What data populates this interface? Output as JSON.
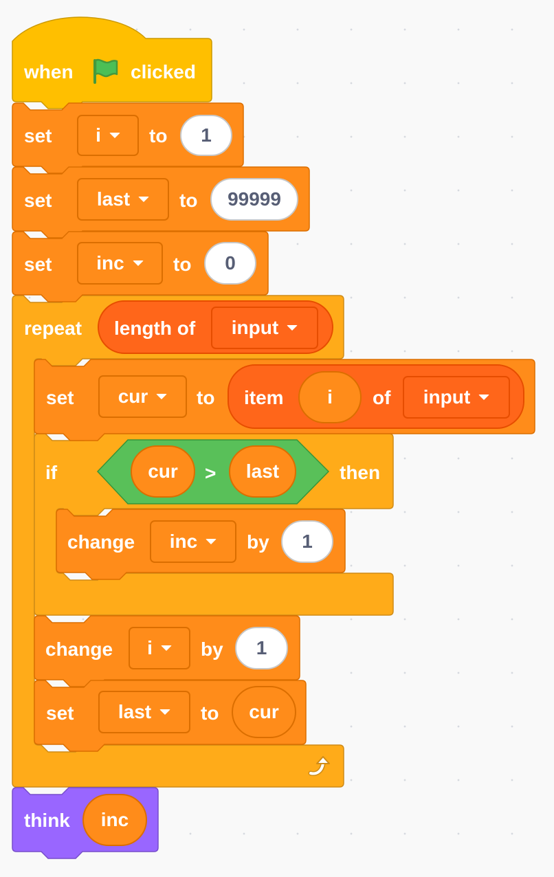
{
  "colors": {
    "events": "#ffbf00",
    "variables": "#ff8c1a",
    "control": "#ffab19",
    "operators": "#59c059",
    "looks": "#9966ff",
    "list": "#ff661a",
    "flag": "#4cbf56"
  },
  "script": {
    "hat": {
      "when": "when",
      "flag_icon": "green-flag-icon",
      "clicked": "clicked"
    },
    "set_i": {
      "set": "set",
      "var": "i",
      "to": "to",
      "value": "1"
    },
    "set_last": {
      "set": "set",
      "var": "last",
      "to": "to",
      "value": "99999"
    },
    "set_inc": {
      "set": "set",
      "var": "inc",
      "to": "to",
      "value": "0"
    },
    "repeat": {
      "label": "repeat",
      "length_of": "length of",
      "list": "input"
    },
    "set_cur": {
      "set": "set",
      "var": "cur",
      "to": "to",
      "item": "item",
      "index": "i",
      "of": "of",
      "list": "input"
    },
    "if_block": {
      "if": "if",
      "left": "cur",
      "op": ">",
      "right": "last",
      "then": "then"
    },
    "change_inc": {
      "change": "change",
      "var": "inc",
      "by": "by",
      "value": "1"
    },
    "change_i": {
      "change": "change",
      "var": "i",
      "by": "by",
      "value": "1"
    },
    "set_last2": {
      "set": "set",
      "var": "last",
      "to": "to",
      "value": "cur"
    },
    "loop_arrow_icon": "loop-arrow-icon",
    "think": {
      "label": "think",
      "value": "inc"
    }
  }
}
